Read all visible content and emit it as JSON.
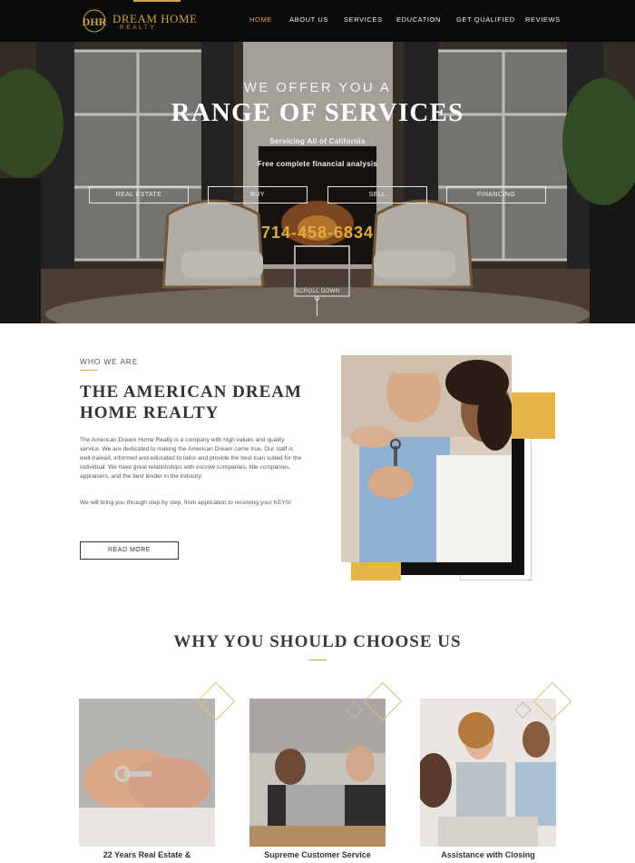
{
  "nav": {
    "brand": "DREAM HOME",
    "brand_sub": "REALTY",
    "monogram": "DHR",
    "items": [
      {
        "label": "HOME",
        "active": true
      },
      {
        "label": "ABOUT US",
        "active": false
      },
      {
        "label": "SERVICES",
        "active": false
      },
      {
        "label": "EDUCATION",
        "active": false
      },
      {
        "label": "GET QUALIFIED",
        "active": false
      },
      {
        "label": "REVIEWS",
        "active": false
      }
    ]
  },
  "hero": {
    "line1": "WE OFFER YOU A",
    "line2": "RANGE OF SERVICES",
    "line3": "Servicing All of California",
    "line4": "Free complete financial analysis",
    "buttons": [
      "REAL ESTATE",
      "BUY",
      "SELL",
      "FINANCING"
    ],
    "phone": "714-458-6834",
    "scroll_label": "SCROLL DOWN"
  },
  "about": {
    "eyebrow": "WHO WE ARE",
    "title_line1": "THE AMERICAN DREAM",
    "title_line2": "HOME REALTY",
    "paragraph1": "The American Dream Home Realty is a company with high values and quality service. We are dedicated to making the American Dream come true. Our staff is well-trained, informed and educated to tailor and provide the best loan suited for the individual. We have great relationships with escrow companies, title companies, appraisers, and the best lender in the industry.",
    "paragraph2": "We will bring you through step by step, from application to receiving your KEYS!",
    "button": "READ MORE"
  },
  "why": {
    "title": "WHY YOU SHOULD CHOOSE US",
    "cards": [
      {
        "title": "22 Years Real Estate &"
      },
      {
        "title": "Supreme Customer Service"
      },
      {
        "title": "Assistance with Closing"
      }
    ]
  },
  "colors": {
    "accent": "#e0a94a",
    "gold_block": "#e5b548",
    "nav_bg": "#0b0b0b",
    "text_dark": "#333333"
  }
}
